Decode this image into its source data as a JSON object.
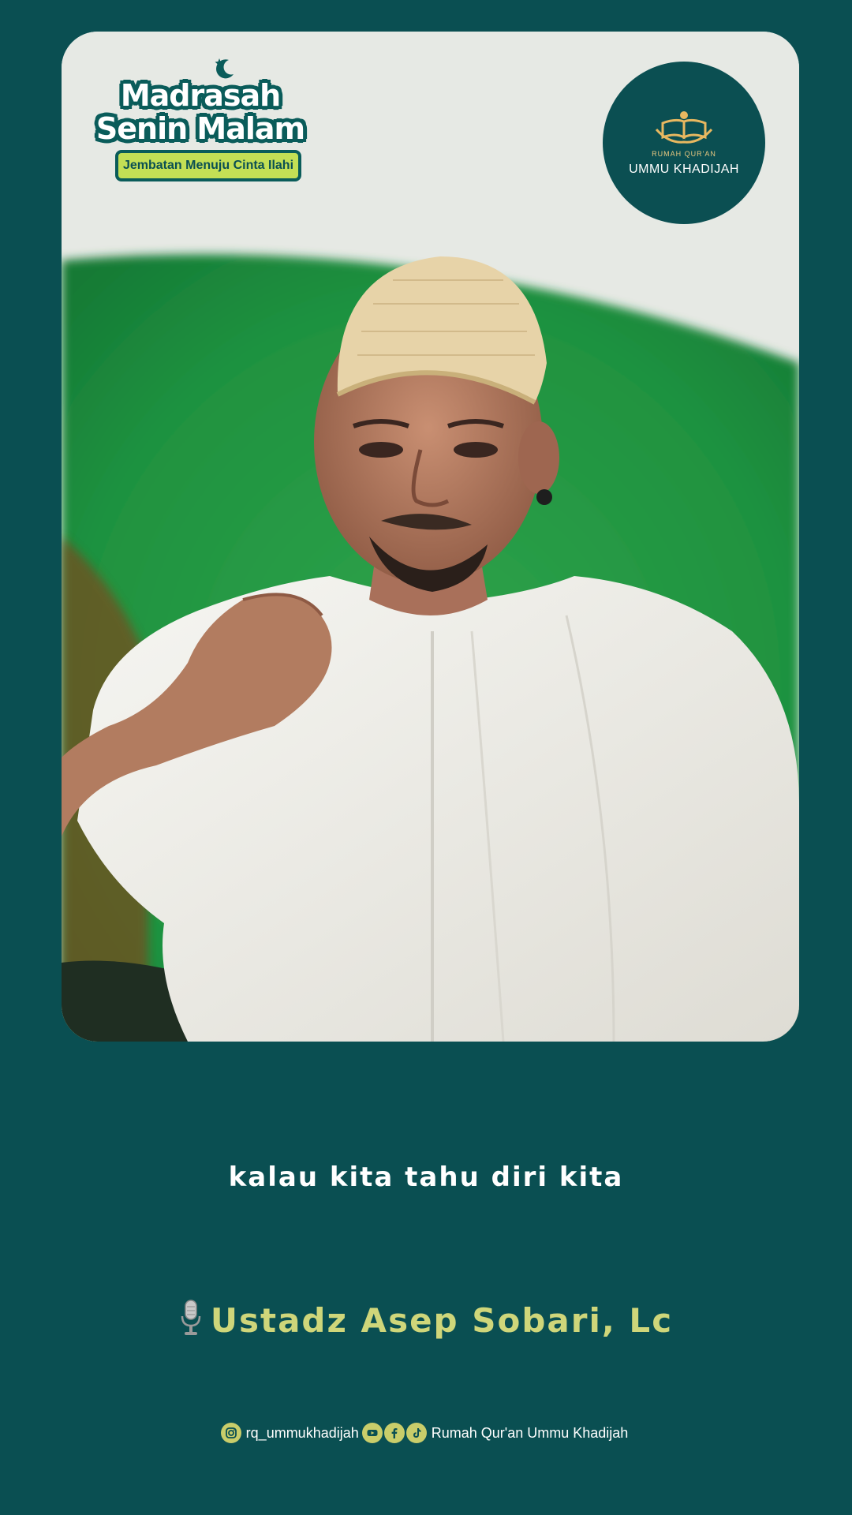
{
  "badge": {
    "title_line1": "Madrasah",
    "title_line2": "Senin Malam",
    "subtitle": "Jembatan Menuju Cinta Ilahi"
  },
  "logo": {
    "small_text": "RUMAH QUR'AN",
    "name": "UMMU KHADIJAH"
  },
  "caption": "kalau kita tahu diri kita",
  "speaker": {
    "icon": "microphone-icon",
    "name": "Ustadz Asep Sobari, Lc"
  },
  "footer": {
    "instagram_icon": "instagram-icon",
    "instagram_handle": "rq_ummukhadijah",
    "youtube_icon": "youtube-icon",
    "facebook_icon": "facebook-icon",
    "tiktok_icon": "tiktok-icon",
    "channel_name": "Rumah Qur'an Ummu Khadijah"
  },
  "colors": {
    "background": "#0a4f52",
    "accent_yellow": "#cfd67a",
    "badge_green": "#c3df55"
  }
}
